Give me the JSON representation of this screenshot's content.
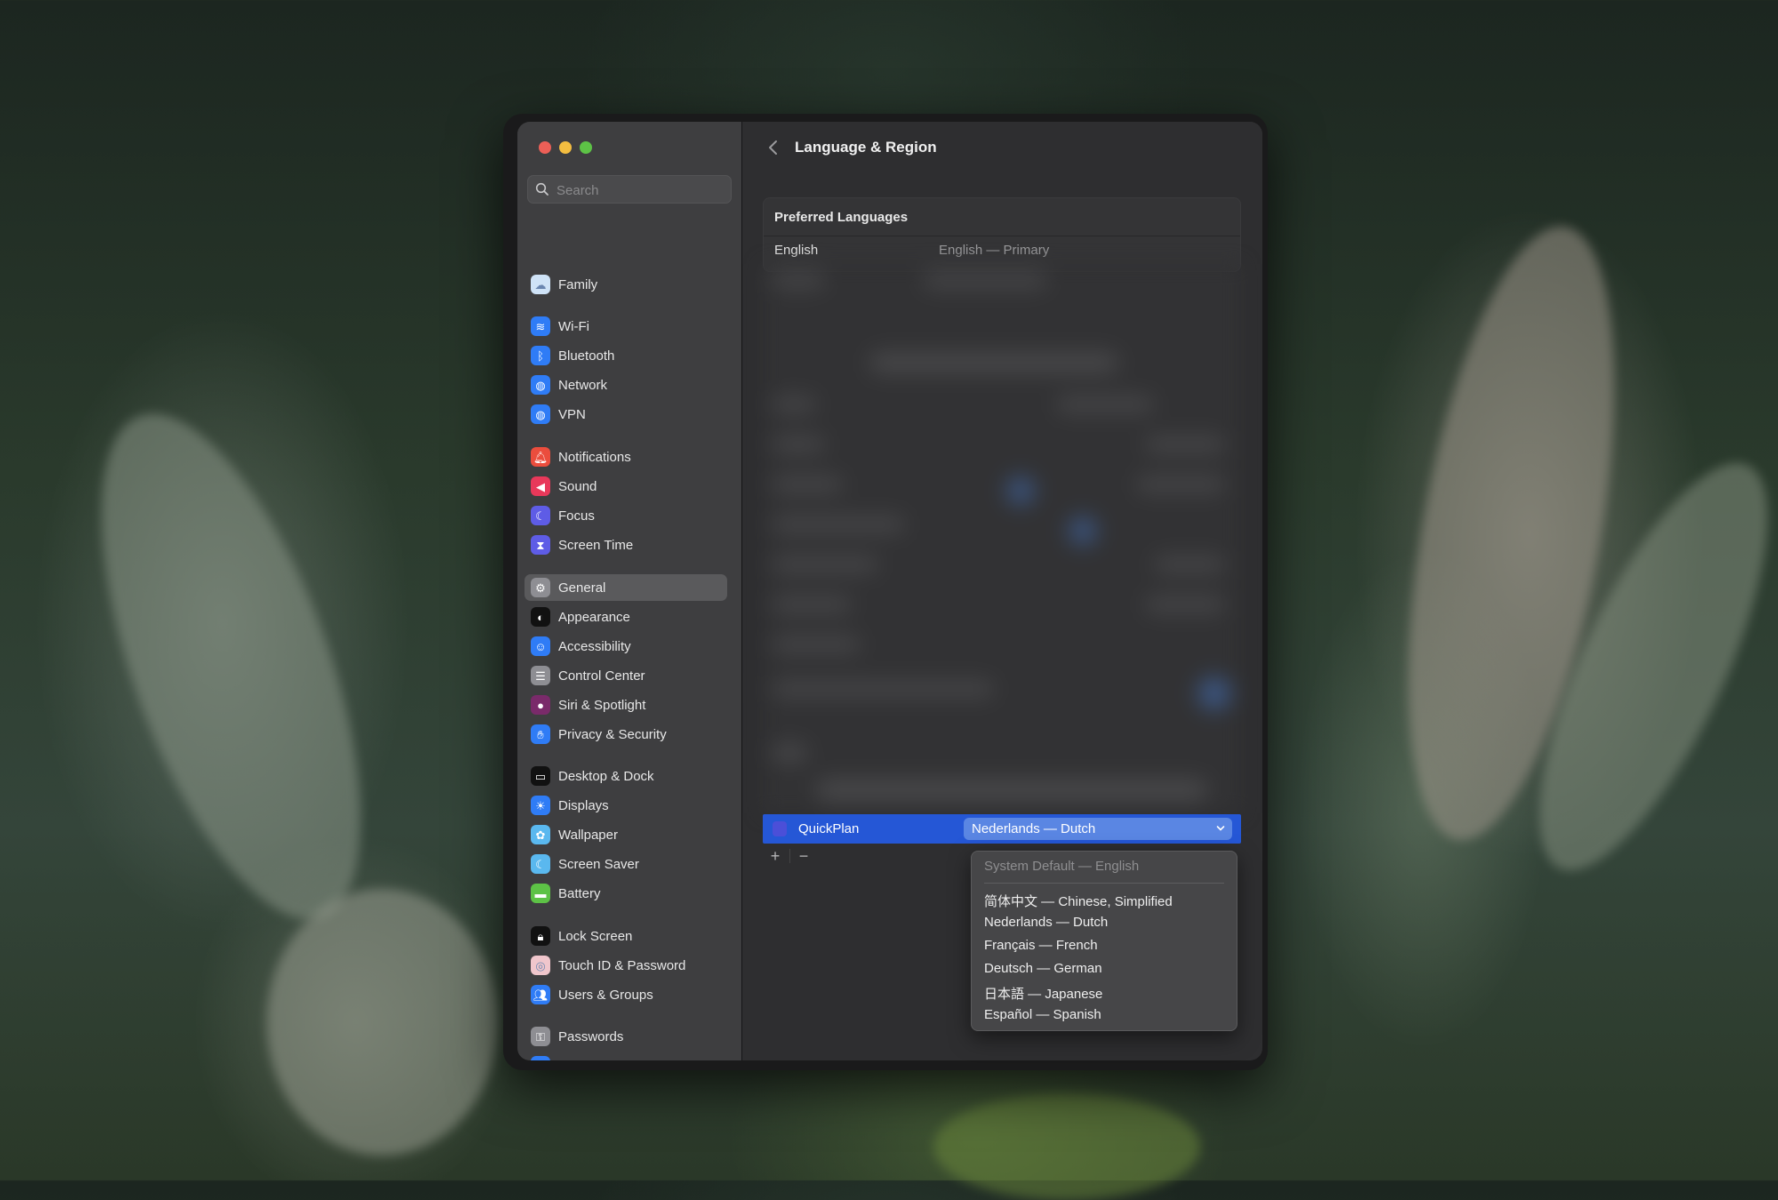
{
  "window": {
    "traffic_lights": {
      "close_color": "#ec5f57",
      "minimize_color": "#f3bd40",
      "maximize_color": "#5dc246"
    }
  },
  "sidebar": {
    "search": {
      "placeholder": "Search",
      "value": ""
    },
    "selected": "General",
    "items": [
      {
        "label": "Family",
        "icon": "family-icon",
        "color": "#cfe3f7"
      },
      {
        "label": "Wi-Fi",
        "icon": "wifi-icon",
        "color": "#2f7cf6"
      },
      {
        "label": "Bluetooth",
        "icon": "bluetooth-icon",
        "color": "#2f7cf6"
      },
      {
        "label": "Network",
        "icon": "network-globe-icon",
        "color": "#2f7cf6"
      },
      {
        "label": "VPN",
        "icon": "vpn-globe-icon",
        "color": "#2f7cf6"
      },
      {
        "label": "Notifications",
        "icon": "notifications-bell-icon",
        "color": "#eb4d3d"
      },
      {
        "label": "Sound",
        "icon": "sound-speaker-icon",
        "color": "#e8385a"
      },
      {
        "label": "Focus",
        "icon": "focus-moon-icon",
        "color": "#5e5ce6"
      },
      {
        "label": "Screen Time",
        "icon": "screen-time-hourglass-icon",
        "color": "#5e5ce6"
      },
      {
        "label": "General",
        "icon": "general-gear-icon",
        "color": "#8e8e93"
      },
      {
        "label": "Appearance",
        "icon": "appearance-icon",
        "color": "#111111"
      },
      {
        "label": "Accessibility",
        "icon": "accessibility-icon",
        "color": "#2f7cf6"
      },
      {
        "label": "Control Center",
        "icon": "control-center-icon",
        "color": "#8e8e93"
      },
      {
        "label": "Siri & Spotlight",
        "icon": "siri-icon",
        "color": "#7a2a6a"
      },
      {
        "label": "Privacy & Security",
        "icon": "privacy-hand-icon",
        "color": "#2f7cf6"
      },
      {
        "label": "Desktop & Dock",
        "icon": "desktop-dock-icon",
        "color": "#111111"
      },
      {
        "label": "Displays",
        "icon": "displays-sun-icon",
        "color": "#2f7cf6"
      },
      {
        "label": "Wallpaper",
        "icon": "wallpaper-flower-icon",
        "color": "#5ab8ef"
      },
      {
        "label": "Screen Saver",
        "icon": "screen-saver-icon",
        "color": "#5ab8ef"
      },
      {
        "label": "Battery",
        "icon": "battery-icon",
        "color": "#5dc246"
      },
      {
        "label": "Lock Screen",
        "icon": "lock-screen-icon",
        "color": "#111111"
      },
      {
        "label": "Touch ID & Password",
        "icon": "touch-id-fingerprint-icon",
        "color": "#f0c6cc"
      },
      {
        "label": "Users & Groups",
        "icon": "users-groups-icon",
        "color": "#2f7cf6"
      },
      {
        "label": "Passwords",
        "icon": "passwords-key-icon",
        "color": "#8e8e93"
      }
    ]
  },
  "main": {
    "title": "Language & Region",
    "preferred_languages": {
      "header": "Preferred Languages",
      "rows": [
        {
          "name": "English",
          "value": "English — Primary"
        }
      ]
    },
    "app_row": {
      "app_name": "QuickPlan",
      "selected_language": "Nederlands — Dutch",
      "accent_color": "#2557d6"
    },
    "list_tools": {
      "add": "+",
      "remove": "−"
    },
    "language_popup": {
      "items": [
        {
          "label": "System Default — English",
          "disabled": true
        },
        {
          "label": "简体中文 — Chinese, Simplified",
          "disabled": false
        },
        {
          "label": "Nederlands — Dutch",
          "disabled": false
        },
        {
          "label": "Français — French",
          "disabled": false
        },
        {
          "label": "Deutsch — German",
          "disabled": false
        },
        {
          "label": "日本語 — Japanese",
          "disabled": false
        },
        {
          "label": "Español — Spanish",
          "disabled": false
        }
      ]
    }
  }
}
